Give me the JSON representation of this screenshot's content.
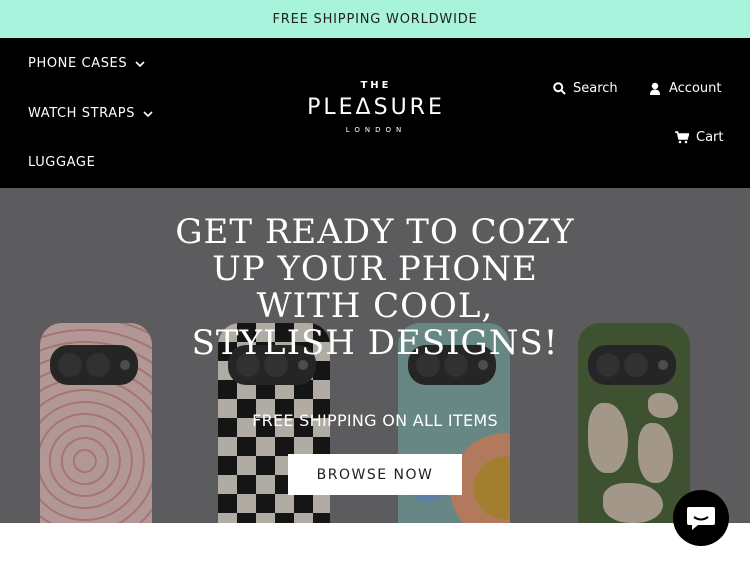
{
  "announcement": {
    "text": "FREE SHIPPING WORLDWIDE"
  },
  "nav": {
    "items": [
      {
        "label": "PHONE CASES",
        "has_dropdown": true
      },
      {
        "label": "WATCH STRAPS",
        "has_dropdown": true
      },
      {
        "label": "LUGGAGE",
        "has_dropdown": false
      }
    ]
  },
  "logo": {
    "top": "THE",
    "main": "PLEΔSURE",
    "sub": "LONDON"
  },
  "header_links": {
    "search": "Search",
    "account": "Account",
    "cart": "Cart"
  },
  "hero": {
    "title": "GET READY TO COZY UP YOUR PHONE WITH COOL, STYLISH DESIGNS!",
    "subtitle": "FREE SHIPPING ON ALL ITEMS",
    "button": "BROWSE NOW"
  },
  "colors": {
    "announcement_bg": "#a8f3dc",
    "header_bg": "#000000",
    "hero_bg": "#6d6d70"
  },
  "icons": [
    "chevron-down-icon",
    "search-icon",
    "user-icon",
    "cart-icon",
    "chat-icon"
  ]
}
